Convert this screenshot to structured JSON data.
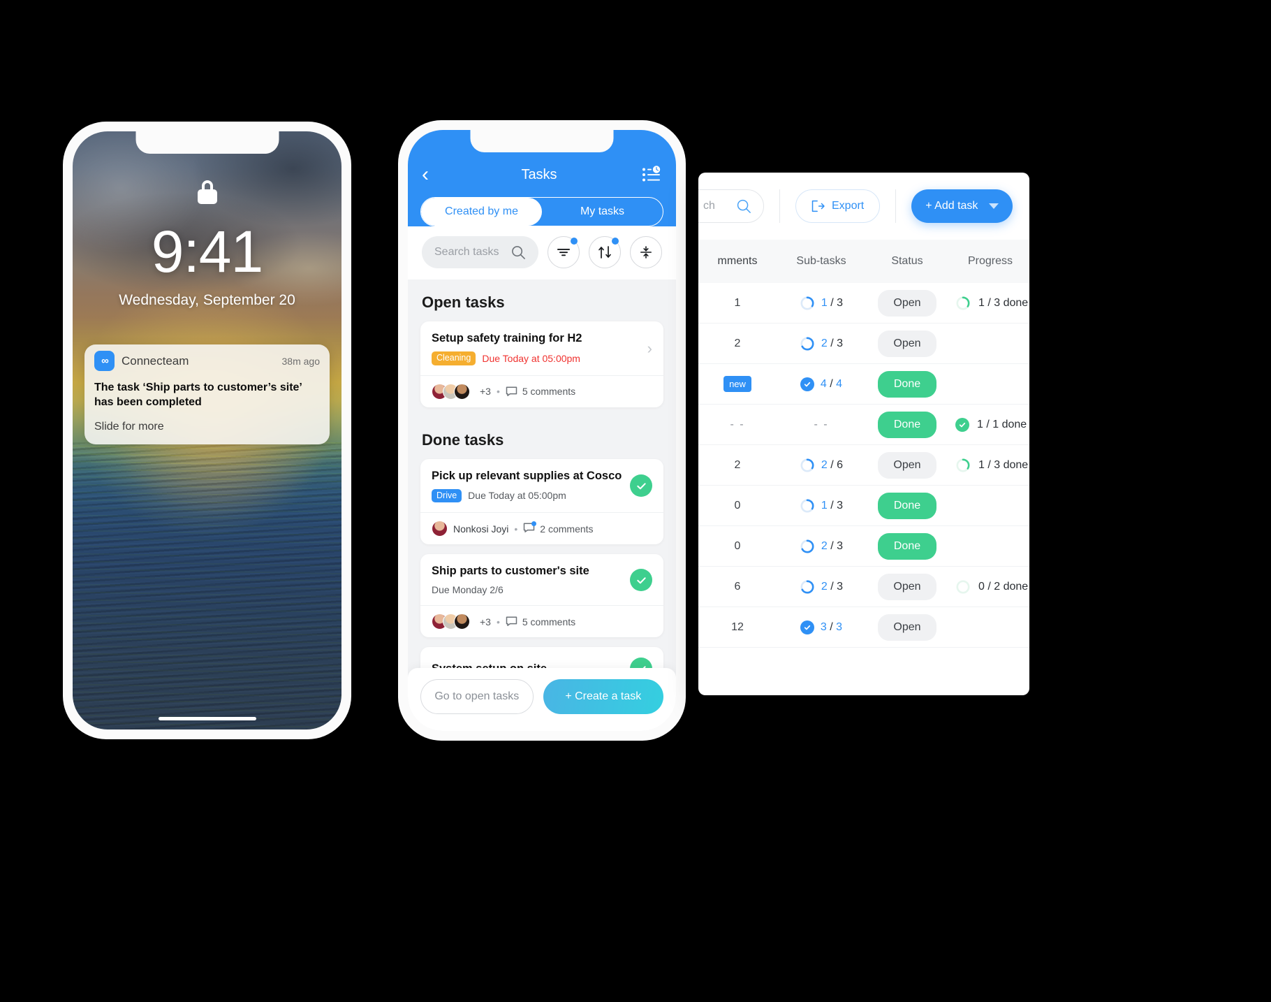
{
  "lock_screen": {
    "time": "9:41",
    "date": "Wednesday, September 20",
    "lock_icon": "lock-icon",
    "notification": {
      "app_icon": "connecteam-logo-icon",
      "app_name": "Connecteam",
      "timestamp": "38m ago",
      "title": "The task ‘Ship parts to customer’s site’ has been completed",
      "subtitle": "Slide for more"
    }
  },
  "mobile_app": {
    "header": {
      "back_icon": "chevron-left-icon",
      "title": "Tasks",
      "list_clock_icon": "list-clock-icon"
    },
    "tabs": [
      {
        "label": "Created by me",
        "active": true
      },
      {
        "label": "My tasks",
        "active": false
      }
    ],
    "search": {
      "placeholder": "Search tasks",
      "search_icon": "search-icon"
    },
    "toolbar_buttons": [
      {
        "name": "filter-button",
        "icon": "filter-icon",
        "has_badge": true
      },
      {
        "name": "sort-button",
        "icon": "sort-arrows-icon",
        "has_badge": true
      },
      {
        "name": "collapse-button",
        "icon": "collapse-arrows-icon",
        "has_badge": false
      }
    ],
    "sections": [
      {
        "title": "Open tasks",
        "tasks": [
          {
            "title": "Setup safety training for H2",
            "chip": "Cleaning",
            "chip_color": "#f5ae30",
            "due": "Due Today at 05:00pm",
            "due_overdue": true,
            "done": false,
            "footer_type": "avatars",
            "extra_people": "+3",
            "comments": "5 comments",
            "comment_badge": false
          }
        ]
      },
      {
        "title": "Done tasks",
        "tasks": [
          {
            "title": "Pick up relevant supplies at Cosco",
            "chip": "Drive",
            "chip_color": "#2f90f5",
            "due": "Due Today at 05:00pm",
            "due_overdue": false,
            "done": true,
            "footer_type": "person",
            "person": "Nonkosi Joyi",
            "comments": "2 comments",
            "comment_badge": true
          },
          {
            "title": "Ship parts to customer's site",
            "chip": null,
            "due": "Due Monday 2/6",
            "due_overdue": false,
            "done": true,
            "footer_type": "avatars",
            "extra_people": "+3",
            "comments": "5 comments",
            "comment_badge": false
          },
          {
            "title": "System setup on site",
            "chip": null,
            "due": null,
            "done": true,
            "footer_type": "none"
          }
        ]
      }
    ],
    "footer": {
      "secondary_label": "Go to open tasks",
      "primary_label": "+ Create a task"
    }
  },
  "desktop_panel": {
    "toolbar": {
      "search_value_visible": "ch",
      "search_icon": "search-icon",
      "export_label": "Export",
      "export_icon": "export-icon",
      "add_task_label": "+ Add task",
      "add_task_caret": "caret-down-icon"
    },
    "table": {
      "columns": [
        "mments",
        "Sub-tasks",
        "Status",
        "Progress"
      ],
      "rows": [
        {
          "comments": "1",
          "sub_done": "1",
          "sub_total": "3",
          "sub_complete": false,
          "status": "Open",
          "progress": "1 / 3 done",
          "progress_state": "partial"
        },
        {
          "comments": "2",
          "sub_done": "2",
          "sub_total": "3",
          "sub_complete": false,
          "status": "Open",
          "progress": null,
          "progress_state": "none"
        },
        {
          "comments": "new",
          "sub_done": "4",
          "sub_total": "4",
          "sub_complete": true,
          "status": "Done",
          "progress": null,
          "progress_state": "none"
        },
        {
          "comments": "- -",
          "sub_done": null,
          "sub_total": null,
          "sub_complete": false,
          "status": "Done",
          "progress": "1 / 1 done",
          "progress_state": "complete"
        },
        {
          "comments": "2",
          "sub_done": "2",
          "sub_total": "6",
          "sub_complete": false,
          "status": "Open",
          "progress": "1 / 3 done",
          "progress_state": "partial"
        },
        {
          "comments": "0",
          "sub_done": "1",
          "sub_total": "3",
          "sub_complete": false,
          "status": "Done",
          "progress": null,
          "progress_state": "none"
        },
        {
          "comments": "0",
          "sub_done": "2",
          "sub_total": "3",
          "sub_complete": false,
          "status": "Done",
          "progress": null,
          "progress_state": "none"
        },
        {
          "comments": "6",
          "sub_done": "2",
          "sub_total": "3",
          "sub_complete": false,
          "status": "Open",
          "progress": "0 / 2 done",
          "progress_state": "empty"
        },
        {
          "comments": "12",
          "sub_done": "3",
          "sub_total": "3",
          "sub_complete": true,
          "status": "Open",
          "progress": null,
          "progress_state": "none"
        }
      ]
    }
  },
  "colors": {
    "brand_blue": "#2f90f5",
    "done_green": "#3ecf8e",
    "overdue_red": "#f0322f",
    "chip_orange": "#f5ae30",
    "background": "#000000"
  }
}
